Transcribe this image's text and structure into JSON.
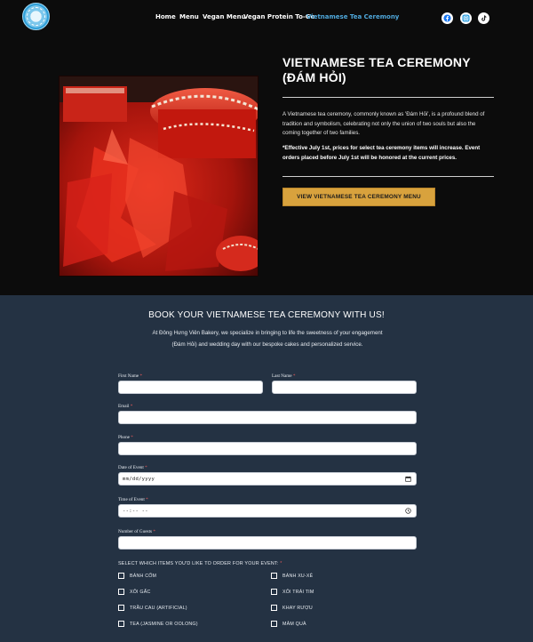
{
  "header": {
    "logo_name": "bakery-logo",
    "nav": [
      {
        "label": "Home",
        "active": false
      },
      {
        "label": "Menu",
        "active": false
      },
      {
        "label": "Vegan Menu",
        "active": false
      },
      {
        "label": "Vegan Protein To-Go",
        "active": false
      },
      {
        "label": "Vietnamese Tea Ceremony",
        "active": true
      }
    ],
    "social": [
      {
        "icon": "facebook-icon"
      },
      {
        "icon": "instagram-icon"
      },
      {
        "icon": "tiktok-icon"
      }
    ]
  },
  "hero": {
    "title": "VIETNAMESE TEA CEREMONY (ĐÁM HỎI)",
    "description": "A Vietnamese tea ceremony, commonly known as 'Đám Hỏi', is a profound blend of tradition and symbolism, celebrating not only the union of two souls but also the coming together of two families.",
    "note": "*Effective July 1st, prices for select tea ceremony items will increase. Event orders placed before July 1st will be honored at the current prices.",
    "cta_label": "VIEW VIETNAMESE TEA CEREMONY MENU"
  },
  "booking": {
    "title": "BOOK YOUR VIETNAMESE TEA CEREMONY WITH US!",
    "intro": "At Đông Hưng Viên Bakery, we specialize in bringing to life the sweetness of your engagement (Đám Hỏi) and wedding day with our bespoke cakes and personalized service.",
    "fields": {
      "first_name": {
        "label": "First Name",
        "required": "*",
        "value": ""
      },
      "last_name": {
        "label": "Last Name",
        "required": "*",
        "value": ""
      },
      "email": {
        "label": "Email",
        "required": "*",
        "value": ""
      },
      "phone": {
        "label": "Phone",
        "required": "*",
        "value": ""
      },
      "date": {
        "label": "Date of Event",
        "required": "*",
        "placeholder": "mm/dd/yyyy"
      },
      "time": {
        "label": "Time of Event",
        "required": "*",
        "placeholder": "--:-- --"
      },
      "guests": {
        "label": "Number of Guests",
        "required": "*",
        "value": ""
      }
    },
    "items_label": "SELECT WHICH ITEMS YOU'D LIKE TO ORDER FOR YOUR EVENT:",
    "items_required": "*",
    "items": [
      {
        "label": "BÁNH CỐM",
        "checked": false
      },
      {
        "label": "BÁNH XU-XÊ",
        "checked": false
      },
      {
        "label": "XÔI GẤC",
        "checked": false
      },
      {
        "label": "XÔI TRÁI TIM",
        "checked": false
      },
      {
        "label": "TRẦU CAU (ARTIFICIAL)",
        "checked": false
      },
      {
        "label": "KHAY RƯỢU",
        "checked": false
      },
      {
        "label": "TEA (JASMINE OR OOLONG)",
        "checked": false
      },
      {
        "label": "MÂM QUÀ",
        "checked": false
      }
    ]
  }
}
